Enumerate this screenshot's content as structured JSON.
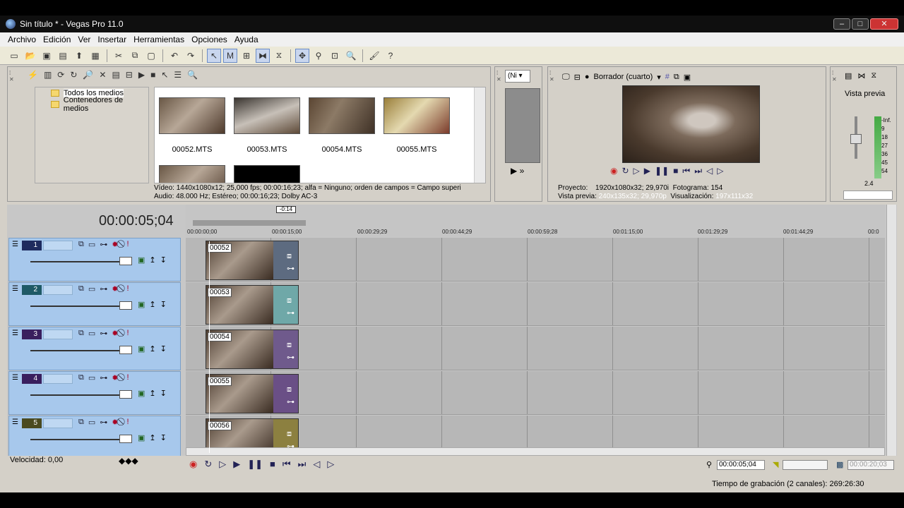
{
  "window": {
    "title": "Sin título * - Vegas Pro 11.0",
    "min": "–",
    "max": "□",
    "close": "✕"
  },
  "menu": [
    "Archivo",
    "Edición",
    "Ver",
    "Insertar",
    "Herramientas",
    "Opciones",
    "Ayuda"
  ],
  "explorer": {
    "tree": [
      "Todos los medios",
      "Contenedores de medios"
    ],
    "thumbs": [
      "00052.MTS",
      "00053.MTS",
      "00054.MTS",
      "00055.MTS"
    ],
    "info_video": "Vídeo: 1440x1080x12; 25,000 fps; 00:00:16;23; alfa = Ninguno; orden de campos = Campo superi",
    "info_audio": "Audio: 48.000 Hz; Estéreo; 00:00:16;23; Dolby AC-3"
  },
  "trimmer": {
    "select": "(Ni ▾"
  },
  "preview": {
    "mode": "Borrador (cuarto)",
    "proyecto_label": "Proyecto:",
    "proyecto_value": "1920x1080x32; 29,970i",
    "fotograma_label": "Fotograma:",
    "fotograma_value": "154",
    "vista_label": "Vista previa:",
    "vista_value": "240x135x32; 29,970p",
    "visual_label": "Visualización:",
    "visual_value": "197x111x32"
  },
  "mixer": {
    "label": "Vista previa",
    "scale": [
      "-Inf.",
      "9",
      "18",
      "27",
      "36",
      "45",
      "54"
    ],
    "bottom": "2.4"
  },
  "timeline": {
    "timecode": "00:00:05;04",
    "cursor_label": "-0:14",
    "ruler": [
      "00:00:00;00",
      "00:00:15;00",
      "00:00:29;29",
      "00:00:44;29",
      "00:00:59;28",
      "00:01:15;00",
      "00:01:29;29",
      "00:01:44;29",
      "00:0"
    ],
    "tracks": [
      {
        "num": "1",
        "clip": "00052",
        "color": "#1f2b5e",
        "clipcolor": "#5d6b80"
      },
      {
        "num": "2",
        "clip": "00053",
        "color": "#1f5a66",
        "clipcolor": "#6fa8a8"
      },
      {
        "num": "3",
        "clip": "00054",
        "color": "#3a1f5e",
        "clipcolor": "#6f5a8c"
      },
      {
        "num": "4",
        "clip": "00055",
        "color": "#3a1f5e",
        "clipcolor": "#6a4f86"
      },
      {
        "num": "5",
        "clip": "00056",
        "color": "#4a4a20",
        "clipcolor": "#8c8040"
      }
    ]
  },
  "bottom": {
    "speed": "Velocidad: 0,00",
    "tc1": "00:00:05;04",
    "tc3": "00:00:20;03",
    "status": "Tiempo de grabación (2 canales): 269:26:30"
  },
  "colors": {
    "track_header": "#a7c8ec",
    "timeline_bg": "#b7b7b7"
  }
}
